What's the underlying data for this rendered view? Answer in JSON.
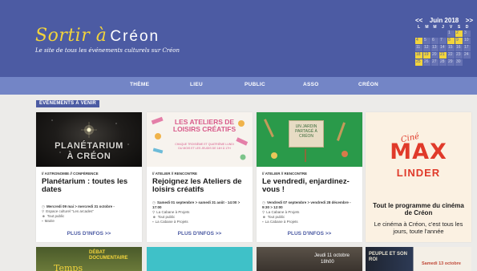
{
  "header": {
    "title_main": "Sortir à",
    "title_brand": "Créon",
    "subtitle": "Le site de tous les événements culturels sur Créon"
  },
  "calendar": {
    "prev": "<<",
    "next": ">>",
    "month": "Juin 2018",
    "dows": [
      "L",
      "M",
      "M",
      "J",
      "V",
      "S",
      "D"
    ],
    "days": [
      {
        "d": "",
        "t": "empty"
      },
      {
        "d": "",
        "t": "empty"
      },
      {
        "d": "",
        "t": "empty"
      },
      {
        "d": "",
        "t": "empty"
      },
      {
        "d": "1",
        "t": "normal"
      },
      {
        "d": "2",
        "t": "event"
      },
      {
        "d": "3",
        "t": "normal"
      },
      {
        "d": "4",
        "t": "event"
      },
      {
        "d": "5",
        "t": "normal"
      },
      {
        "d": "6",
        "t": "normal"
      },
      {
        "d": "7",
        "t": "normal"
      },
      {
        "d": "8",
        "t": "event"
      },
      {
        "d": "9",
        "t": "event"
      },
      {
        "d": "10",
        "t": "normal"
      },
      {
        "d": "11",
        "t": "normal"
      },
      {
        "d": "12",
        "t": "normal"
      },
      {
        "d": "13",
        "t": "normal"
      },
      {
        "d": "14",
        "t": "normal"
      },
      {
        "d": "15",
        "t": "normal"
      },
      {
        "d": "16",
        "t": "normal"
      },
      {
        "d": "17",
        "t": "normal"
      },
      {
        "d": "18",
        "t": "event"
      },
      {
        "d": "19",
        "t": "event"
      },
      {
        "d": "20",
        "t": "normal"
      },
      {
        "d": "21",
        "t": "event"
      },
      {
        "d": "22",
        "t": "normal"
      },
      {
        "d": "23",
        "t": "normal"
      },
      {
        "d": "24",
        "t": "normal"
      },
      {
        "d": "25",
        "t": "event"
      },
      {
        "d": "26",
        "t": "normal"
      },
      {
        "d": "27",
        "t": "normal"
      },
      {
        "d": "28",
        "t": "normal"
      },
      {
        "d": "29",
        "t": "normal"
      },
      {
        "d": "30",
        "t": "normal"
      },
      {
        "d": "",
        "t": "empty"
      }
    ]
  },
  "nav": {
    "items": [
      "THÈME",
      "LIEU",
      "PUBLIC",
      "ASSO",
      "CRÉON"
    ]
  },
  "section_label": "ÉVÉNEMENTS À VENIR",
  "cards": [
    {
      "image_text_1": "PLANÉTARIUM",
      "image_text_2": "À CRÉON",
      "cats": "// ASTRONOMIE // CONFÉRENCE",
      "title": "Planétarium : toutes les dates",
      "date": "Mercredi 09 mai > mercredi 31 octobre -",
      "place": "Espace culturel \"Les arcades\"",
      "public": "Tout public",
      "org": "Mairie",
      "link": "PLUS D'INFOS >>"
    },
    {
      "image_title": "LES ATELIERS DE LOISIRS CRÉATIFS",
      "image_line_1": "CHAQUE TROISIÈME ET QUATRIÈME LUNDI",
      "image_line_2": "DU MOIS ET LES JEUDIS DE 14H À 17H",
      "cats": "// ATELIER // RENCONTRE",
      "title": "Rejoignez les Ateliers de loisirs créatifs",
      "date": "Samedi 01 septembre > samedi 31 août - 14:00 > 17:00",
      "place": "La Cabane à Projets",
      "public": "Tout public",
      "org": "La Cabane à Projets",
      "link": "PLUS D'INFOS >>"
    },
    {
      "image_sign": "UN JARDIN PARTAGÉ À CRÉON",
      "cats": "// ATELIER // RENCONTRE",
      "title": "Le vendredi, enjardinez-vous !",
      "date": "Vendredi 07 septembre > vendredi 28 décembre - 9:30 > 12:00",
      "place": "La Cabane à Projets",
      "public": "Tout public",
      "org": "La Cabane à Projets",
      "link": "PLUS D'INFOS >>"
    },
    {
      "cine": "Ciné",
      "big": "MAX",
      "sub": "LINDER",
      "prog": "Tout le programme du cinéma de Créon",
      "desc": "Le cinéma à Créon, c'est tous les jours, toute l'année"
    }
  ],
  "bottom_cards": [
    {
      "text": "Temps",
      "text2": "DÉBAT DOCUMENTAIRE"
    },
    {
      "text": ""
    },
    {
      "text": "Jeudi 11 octobre",
      "text2": "18h00"
    },
    {
      "text": "PEUPLE ET SON ROI",
      "text2": "Samedi 13 octobre"
    }
  ],
  "icons": {
    "date": "calendar-icon",
    "place": "pin-icon",
    "public": "people-icon",
    "org": "building-icon"
  },
  "colors": {
    "header_bg": "#4c5ba3",
    "nav_bg": "#7385c6",
    "accent_yellow": "#f2d43c",
    "max_red": "#e03a2a"
  }
}
